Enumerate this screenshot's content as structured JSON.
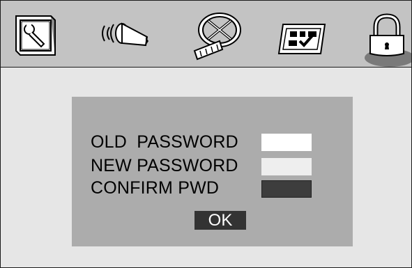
{
  "menu": {
    "tabs": [
      {
        "name": "setup",
        "icon": "wrench-monitor-icon"
      },
      {
        "name": "audio",
        "icon": "speaker-icon"
      },
      {
        "name": "video",
        "icon": "film-reel-icon"
      },
      {
        "name": "preference",
        "icon": "checklist-icon"
      },
      {
        "name": "password",
        "icon": "lock-icon",
        "selected": true
      }
    ]
  },
  "password_dialog": {
    "old_password_label": "OLD  PASSWORD",
    "new_password_label": "NEW PASSWORD",
    "confirm_label": "CONFIRM PWD",
    "old_password_value": "",
    "new_password_value": "",
    "confirm_value": "",
    "ok_label": "OK"
  },
  "colors": {
    "topbar": "#c3c3c3",
    "background": "#e6e6e6",
    "dialog": "#acacac",
    "button": "#333333"
  }
}
